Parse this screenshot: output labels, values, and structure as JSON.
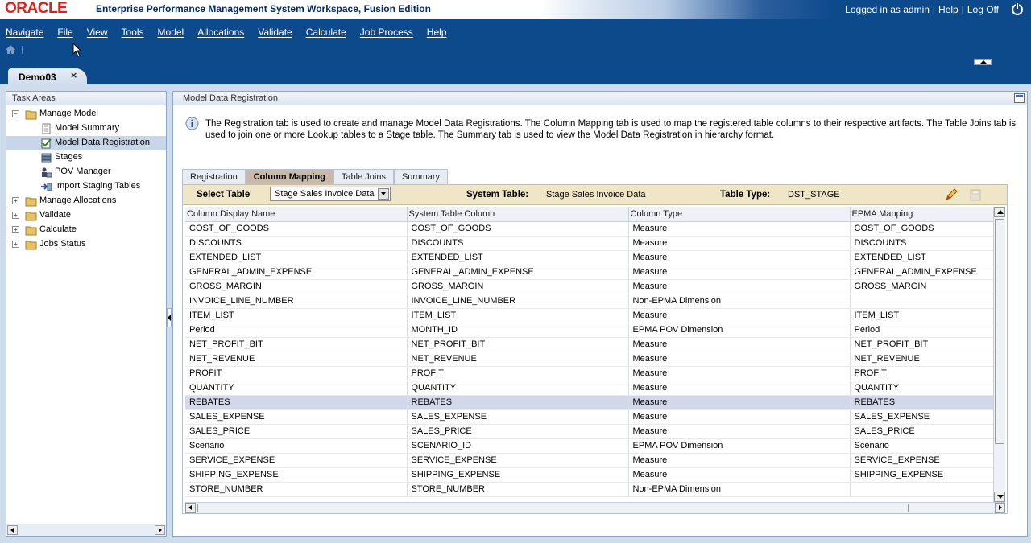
{
  "app": {
    "logo": "ORACLE",
    "product_title": "Enterprise Performance Management System Workspace, Fusion Edition",
    "logged_in": "Logged in as admin",
    "help": "Help",
    "logoff": "Log Off"
  },
  "menu": [
    "Navigate",
    "File",
    "View",
    "Tools",
    "Model",
    "Allocations",
    "Validate",
    "Calculate",
    "Job Process",
    "Help"
  ],
  "doc_tab": {
    "label": "Demo03",
    "close": "×"
  },
  "task_areas": {
    "title": "Task Areas",
    "items": [
      {
        "label": "Manage Model",
        "toggle": "−"
      },
      {
        "label": "Model Summary"
      },
      {
        "label": "Model Data Registration"
      },
      {
        "label": "Stages"
      },
      {
        "label": "POV Manager"
      },
      {
        "label": "Import Staging Tables"
      },
      {
        "label": "Manage Allocations",
        "toggle": "+"
      },
      {
        "label": "Validate",
        "toggle": "+"
      },
      {
        "label": "Calculate",
        "toggle": "+"
      },
      {
        "label": "Jobs Status",
        "toggle": "+"
      }
    ]
  },
  "main": {
    "title": "Model Data Registration",
    "info": "The Registration tab is used to create and manage Model Data Registrations.  The Column Mapping tab is used to map the registered table columns to their respective artifacts.  The Table Joins tab is used to join one or more Lookup tables to a Stage table.  The Summary tab is used to view the Model Data Registration in hierarchy format.",
    "tabs": [
      "Registration",
      "Column Mapping",
      "Table Joins",
      "Summary"
    ],
    "active_tab": "Column Mapping"
  },
  "toolbar": {
    "select_table_label": "Select Table",
    "select_table_value": "Stage Sales Invoice Data",
    "system_table_label": "System Table:",
    "system_table_value": "Stage Sales Invoice Data",
    "table_type_label": "Table Type:",
    "table_type_value": "DST_STAGE"
  },
  "grid": {
    "columns": [
      "Column Display Name",
      "System Table Column",
      "Column Type",
      "EPMA Mapping"
    ],
    "rows": [
      [
        "COST_OF_GOODS",
        "COST_OF_GOODS",
        "Measure",
        "COST_OF_GOODS"
      ],
      [
        "DISCOUNTS",
        "DISCOUNTS",
        "Measure",
        "DISCOUNTS"
      ],
      [
        "EXTENDED_LIST",
        "EXTENDED_LIST",
        "Measure",
        "EXTENDED_LIST"
      ],
      [
        "GENERAL_ADMIN_EXPENSE",
        "GENERAL_ADMIN_EXPENSE",
        "Measure",
        "GENERAL_ADMIN_EXPENSE"
      ],
      [
        "GROSS_MARGIN",
        "GROSS_MARGIN",
        "Measure",
        "GROSS_MARGIN"
      ],
      [
        "INVOICE_LINE_NUMBER",
        "INVOICE_LINE_NUMBER",
        "Non-EPMA Dimension",
        ""
      ],
      [
        "ITEM_LIST",
        "ITEM_LIST",
        "Measure",
        "ITEM_LIST"
      ],
      [
        "Period",
        "MONTH_ID",
        "EPMA POV Dimension",
        "Period"
      ],
      [
        "NET_PROFIT_BIT",
        "NET_PROFIT_BIT",
        "Measure",
        "NET_PROFIT_BIT"
      ],
      [
        "NET_REVENUE",
        "NET_REVENUE",
        "Measure",
        "NET_REVENUE"
      ],
      [
        "PROFIT",
        "PROFIT",
        "Measure",
        "PROFIT"
      ],
      [
        "QUANTITY",
        "QUANTITY",
        "Measure",
        "QUANTITY"
      ],
      [
        "REBATES",
        "REBATES",
        "Measure",
        "REBATES"
      ],
      [
        "SALES_EXPENSE",
        "SALES_EXPENSE",
        "Measure",
        "SALES_EXPENSE"
      ],
      [
        "SALES_PRICE",
        "SALES_PRICE",
        "Measure",
        "SALES_PRICE"
      ],
      [
        "Scenario",
        "SCENARIO_ID",
        "EPMA POV Dimension",
        "Scenario"
      ],
      [
        "SERVICE_EXPENSE",
        "SERVICE_EXPENSE",
        "Measure",
        "SERVICE_EXPENSE"
      ],
      [
        "SHIPPING_EXPENSE",
        "SHIPPING_EXPENSE",
        "Measure",
        "SHIPPING_EXPENSE"
      ],
      [
        "STORE_NUMBER",
        "STORE_NUMBER",
        "Non-EPMA Dimension",
        ""
      ]
    ],
    "selected_row": 12
  }
}
